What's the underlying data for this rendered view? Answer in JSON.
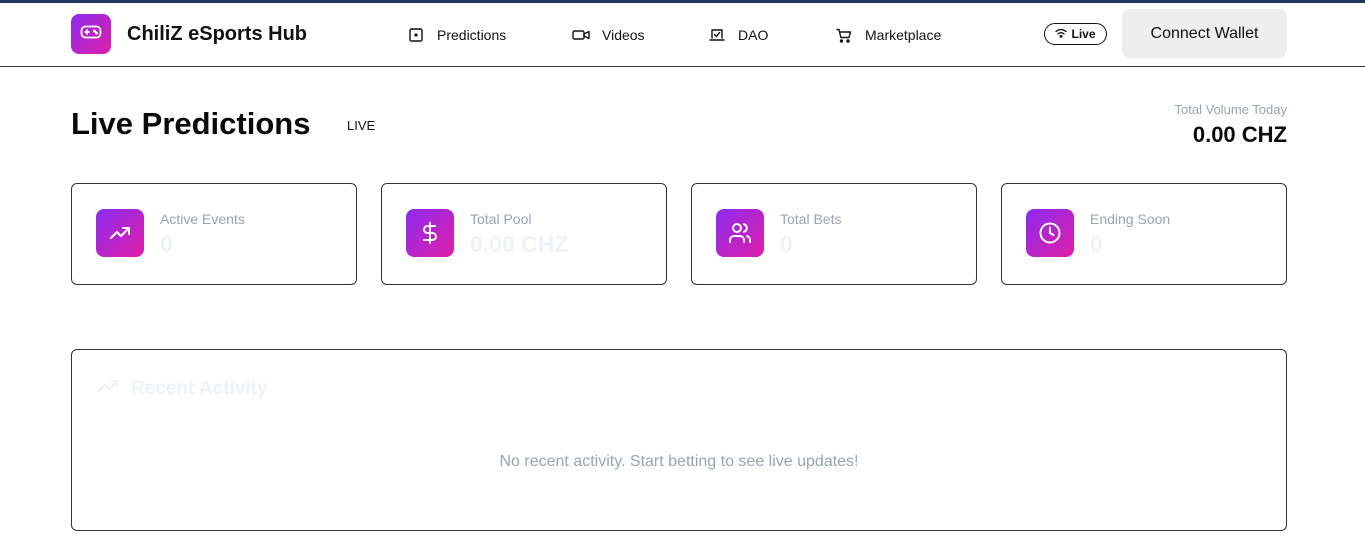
{
  "header": {
    "brand": "ChiliZ eSports Hub",
    "logo_icon": "gamepad-icon",
    "nav": [
      {
        "label": "Predictions",
        "icon": "dice-icon"
      },
      {
        "label": "Videos",
        "icon": "video-icon"
      },
      {
        "label": "DAO",
        "icon": "vote-icon"
      },
      {
        "label": "Marketplace",
        "icon": "cart-icon"
      }
    ],
    "live_badge": "Live",
    "live_icon": "wifi-icon",
    "connect_wallet": "Connect Wallet"
  },
  "page": {
    "title": "Live Predictions",
    "live_text": "LIVE",
    "total_volume_label": "Total Volume Today",
    "total_volume_value": "0.00 CHZ"
  },
  "stats": [
    {
      "label": "Active Events",
      "value": "0",
      "icon": "trending-up-icon"
    },
    {
      "label": "Total Pool",
      "value": "0.00 CHZ",
      "icon": "dollar-icon"
    },
    {
      "label": "Total Bets",
      "value": "0",
      "icon": "users-icon"
    },
    {
      "label": "Ending Soon",
      "value": "0",
      "icon": "clock-icon"
    }
  ],
  "activity": {
    "title": "Recent Activity",
    "icon": "trending-up-icon",
    "empty_message": "No recent activity. Start betting to see live updates!"
  },
  "colors": {
    "accent_start": "#8b2bf0",
    "accent_end": "#e01fa8",
    "muted_text": "#9aa3b2",
    "top_line": "#1e3a5f"
  }
}
